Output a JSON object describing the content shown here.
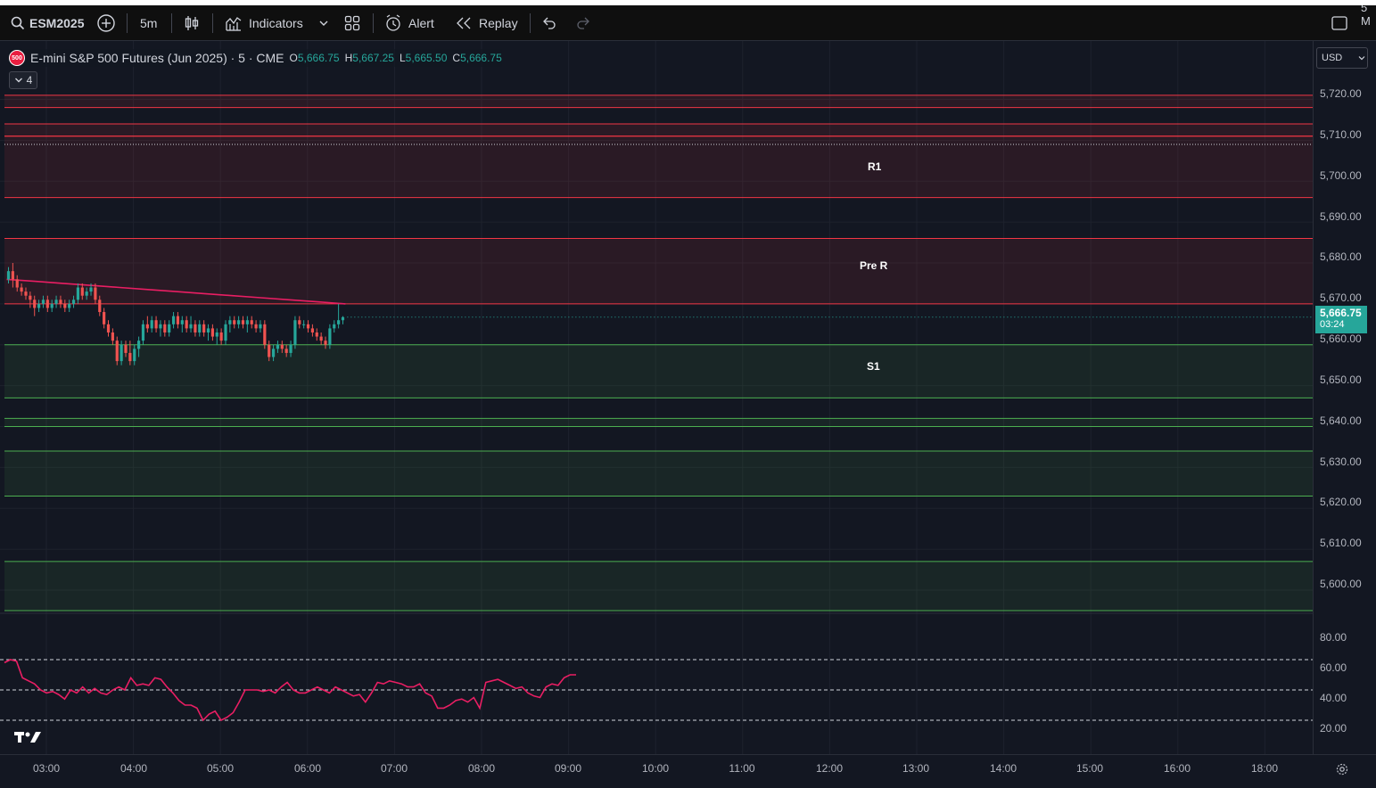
{
  "toolbar": {
    "symbol": "ESM2025",
    "interval": "5m",
    "indicators_label": "Indicators",
    "alert_label": "Alert",
    "replay_label": "Replay",
    "right_text": "5 M"
  },
  "legend": {
    "badge": "500",
    "title": "E-mini S&P 500 Futures (Jun 2025) · 5 · CME",
    "o_key": "O",
    "o_val": "5,666.75",
    "h_key": "H",
    "h_val": "5,667.25",
    "l_key": "L",
    "l_val": "5,665.50",
    "c_key": "C",
    "c_val": "5,666.75",
    "collapse_count": "4"
  },
  "currency": "USD",
  "last_price": {
    "value": "5,666.75",
    "countdown": "03:24"
  },
  "zone_labels": {
    "r1": "R1",
    "pre_r": "Pre R",
    "s1": "S1"
  },
  "price_ticks": [
    "5,720.00",
    "5,710.00",
    "5,700.00",
    "5,690.00",
    "5,680.00",
    "5,670.00",
    "5,660.00",
    "5,650.00",
    "5,640.00",
    "5,630.00",
    "5,620.00",
    "5,610.00",
    "5,600.00"
  ],
  "rsi_ticks": [
    "80.00",
    "60.00",
    "40.00",
    "20.00"
  ],
  "time_ticks": [
    "03:00",
    "04:00",
    "05:00",
    "06:00",
    "07:00",
    "08:00",
    "09:00",
    "10:00",
    "11:00",
    "12:00",
    "13:00",
    "14:00",
    "15:00",
    "16:00",
    "18:00"
  ],
  "colors": {
    "background": "#131722",
    "up": "#26a69a",
    "down": "#ef5350",
    "resistance": "#f23645",
    "support": "#4caf50",
    "rsi": "#e91e63"
  },
  "chart_data": {
    "type": "candlestick",
    "symbol": "ESM2025",
    "interval": "5m",
    "ylim": [
      5595,
      5725
    ],
    "x_start": "02:45",
    "x_end": "09:05",
    "resistance_zones": [
      {
        "label": "",
        "top": 5721,
        "bottom": 5718
      },
      {
        "label": "",
        "top": 5714,
        "bottom": 5711
      },
      {
        "label": "R1",
        "top": 5711,
        "bottom": 5696
      },
      {
        "label": "Pre R",
        "top": 5686,
        "bottom": 5670
      }
    ],
    "support_zones": [
      {
        "label": "S1",
        "top": 5660,
        "bottom": 5647
      },
      {
        "label": "",
        "top": 5642,
        "bottom": 5640
      },
      {
        "label": "",
        "top": 5634,
        "bottom": 5623
      },
      {
        "label": "",
        "top": 5607,
        "bottom": 5595
      }
    ],
    "reference_lines": [
      {
        "value": 5709
      }
    ],
    "ma_line": [
      [
        0,
        5676
      ],
      [
        15,
        5675.5
      ],
      [
        30,
        5675
      ],
      [
        45,
        5674.5
      ],
      [
        60,
        5674
      ],
      [
        75,
        5673.5
      ],
      [
        90,
        5673
      ],
      [
        105,
        5672.5
      ],
      [
        120,
        5672
      ],
      [
        135,
        5671.5
      ],
      [
        150,
        5671
      ],
      [
        165,
        5670.5
      ],
      [
        180,
        5670
      ]
    ],
    "candles": [
      [
        5676,
        5679,
        5675,
        5678
      ],
      [
        5678,
        5680,
        5674,
        5676
      ],
      [
        5676,
        5677,
        5673,
        5674
      ],
      [
        5674,
        5675,
        5672,
        5673
      ],
      [
        5673,
        5674,
        5671,
        5672
      ],
      [
        5672,
        5673,
        5669,
        5671
      ],
      [
        5671,
        5672,
        5667,
        5669
      ],
      [
        5669,
        5671,
        5668,
        5670
      ],
      [
        5670,
        5672,
        5669,
        5671
      ],
      [
        5671,
        5672,
        5668,
        5669
      ],
      [
        5669,
        5671,
        5668,
        5670
      ],
      [
        5670,
        5672,
        5669,
        5671
      ],
      [
        5671,
        5672,
        5669,
        5670
      ],
      [
        5670,
        5671,
        5668,
        5669
      ],
      [
        5669,
        5671,
        5668,
        5670
      ],
      [
        5670,
        5672,
        5669,
        5671
      ],
      [
        5671,
        5675,
        5670,
        5674
      ],
      [
        5674,
        5675,
        5671,
        5672
      ],
      [
        5672,
        5674,
        5671,
        5673
      ],
      [
        5673,
        5675,
        5672,
        5674
      ],
      [
        5674,
        5675,
        5670,
        5671
      ],
      [
        5671,
        5672,
        5667,
        5668
      ],
      [
        5668,
        5669,
        5664,
        5665
      ],
      [
        5665,
        5666,
        5662,
        5663
      ],
      [
        5663,
        5664,
        5660,
        5661
      ],
      [
        5661,
        5662,
        5655,
        5656
      ],
      [
        5656,
        5661,
        5655,
        5660
      ],
      [
        5660,
        5661,
        5657,
        5658
      ],
      [
        5658,
        5661,
        5655,
        5656
      ],
      [
        5656,
        5660,
        5655,
        5659
      ],
      [
        5659,
        5662,
        5657,
        5661
      ],
      [
        5661,
        5666,
        5660,
        5665
      ],
      [
        5665,
        5667,
        5663,
        5664
      ],
      [
        5664,
        5667,
        5663,
        5666
      ],
      [
        5666,
        5667,
        5663,
        5664
      ],
      [
        5664,
        5666,
        5662,
        5665
      ],
      [
        5665,
        5666,
        5662,
        5663
      ],
      [
        5663,
        5666,
        5662,
        5665
      ],
      [
        5665,
        5668,
        5664,
        5667
      ],
      [
        5667,
        5668,
        5664,
        5665
      ],
      [
        5665,
        5667,
        5663,
        5666
      ],
      [
        5666,
        5667,
        5663,
        5664
      ],
      [
        5664,
        5667,
        5663,
        5665
      ],
      [
        5665,
        5666,
        5662,
        5663
      ],
      [
        5663,
        5666,
        5662,
        5665
      ],
      [
        5665,
        5666,
        5662,
        5663
      ],
      [
        5663,
        5665,
        5661,
        5664
      ],
      [
        5664,
        5665,
        5661,
        5662
      ],
      [
        5662,
        5664,
        5660,
        5663
      ],
      [
        5663,
        5664,
        5660,
        5661
      ],
      [
        5661,
        5666,
        5660,
        5665
      ],
      [
        5665,
        5667,
        5663,
        5666
      ],
      [
        5666,
        5667,
        5664,
        5665
      ],
      [
        5665,
        5667,
        5664,
        5666
      ],
      [
        5666,
        5667,
        5664,
        5665
      ],
      [
        5665,
        5667,
        5663,
        5666
      ],
      [
        5666,
        5667,
        5664,
        5665
      ],
      [
        5665,
        5666,
        5663,
        5664
      ],
      [
        5664,
        5666,
        5663,
        5665
      ],
      [
        5665,
        5666,
        5659,
        5660
      ],
      [
        5660,
        5661,
        5656,
        5657
      ],
      [
        5657,
        5660,
        5656,
        5659
      ],
      [
        5659,
        5661,
        5658,
        5660
      ],
      [
        5660,
        5661,
        5658,
        5659
      ],
      [
        5659,
        5660,
        5657,
        5658
      ],
      [
        5658,
        5661,
        5657,
        5660
      ],
      [
        5660,
        5667,
        5659,
        5666
      ],
      [
        5666,
        5667,
        5664,
        5665
      ],
      [
        5665,
        5666,
        5664,
        5665
      ],
      [
        5665,
        5666,
        5663,
        5664
      ],
      [
        5664,
        5665,
        5662,
        5663
      ],
      [
        5663,
        5664,
        5661,
        5662
      ],
      [
        5662,
        5663,
        5660,
        5661
      ],
      [
        5661,
        5662,
        5659,
        5660
      ],
      [
        5660,
        5665,
        5659,
        5664
      ],
      [
        5664,
        5666,
        5663,
        5665
      ],
      [
        5665,
        5670,
        5664,
        5666
      ],
      [
        5666,
        5667,
        5665,
        5666.75
      ]
    ],
    "rsi": {
      "ylim": [
        10,
        90
      ],
      "levels": [
        70,
        50,
        30
      ],
      "values": [
        68,
        70,
        69,
        58,
        56,
        54,
        50,
        48,
        49,
        47,
        44,
        50,
        48,
        52,
        48,
        51,
        48,
        47,
        50,
        52,
        50,
        58,
        53,
        54,
        53,
        58,
        57,
        52,
        48,
        43,
        40,
        40,
        38,
        30,
        34,
        36,
        30,
        32,
        35,
        42,
        50,
        50,
        50,
        49,
        50,
        48,
        52,
        55,
        50,
        48,
        48,
        50,
        52,
        50,
        48,
        52,
        50,
        48,
        46,
        47,
        42,
        48,
        55,
        54,
        56,
        55,
        54,
        52,
        52,
        54,
        48,
        46,
        38,
        38,
        40,
        43,
        44,
        42,
        45,
        38,
        55,
        56,
        57,
        55,
        53,
        51,
        52,
        48,
        46,
        45,
        52,
        54,
        53,
        58,
        60,
        60
      ]
    }
  }
}
